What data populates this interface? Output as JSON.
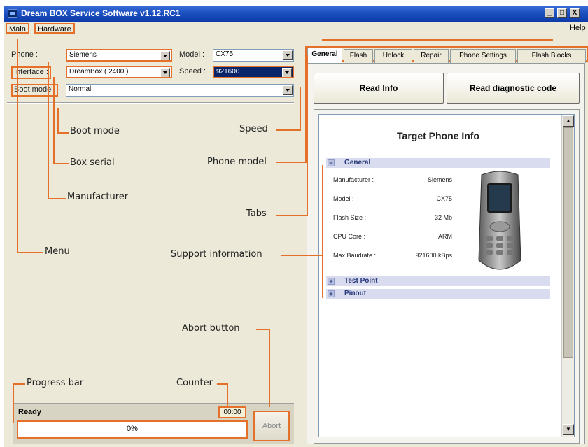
{
  "window": {
    "title": "Dream BOX Service Software v1.12.RC1",
    "min": "_",
    "max": "□",
    "close": "X"
  },
  "menu": {
    "items": [
      "Main",
      "Hardware"
    ],
    "help": "Help"
  },
  "form": {
    "phone_label": "Phone :",
    "phone_value": "Siemens",
    "model_label": "Model :",
    "model_value": "CX75",
    "interface_label": "Interface :",
    "interface_value": "DreamBox ( 2400 )",
    "speed_label": "Speed :",
    "speed_value": "921600",
    "bootmode_label": "Boot mode :",
    "bootmode_value": "Normal"
  },
  "annotations": {
    "boot_mode": "Boot mode",
    "box_serial": "Box serial",
    "manufacturer": "Manufacturer",
    "menu": "Menu",
    "speed": "Speed",
    "phone_model": "Phone model",
    "tabs": "Tabs",
    "support_information": "Support information",
    "abort_button": "Abort button",
    "counter": "Counter",
    "progress_bar": "Progress bar"
  },
  "status": {
    "text": "Ready",
    "counter": "00:00",
    "progress_label": "0%",
    "progress": 0,
    "abort_label": "Abort"
  },
  "tabs": [
    "General",
    "Flash",
    "Unlock",
    "Repair",
    "Phone Settings",
    "Flash Blocks"
  ],
  "buttons": {
    "read_info": "Read Info",
    "read_diag": "Read diagnostic code"
  },
  "info": {
    "title": "Target Phone Info",
    "sections": [
      {
        "expander": "−",
        "name": "General"
      },
      {
        "expander": "+",
        "name": "Test Point"
      },
      {
        "expander": "+",
        "name": "Pinout"
      }
    ],
    "rows": [
      {
        "key": "Manufacturer :",
        "value": "Siemens"
      },
      {
        "key": "Model :",
        "value": "CX75"
      },
      {
        "key": "Flash Size :",
        "value": "32 Mb"
      },
      {
        "key": "CPU Core :",
        "value": "ARM"
      },
      {
        "key": "Max Baudrate :",
        "value": "921600 kBps"
      }
    ]
  },
  "colors": {
    "highlight": "#e4702a",
    "titlebar": "#1c4fbf"
  }
}
